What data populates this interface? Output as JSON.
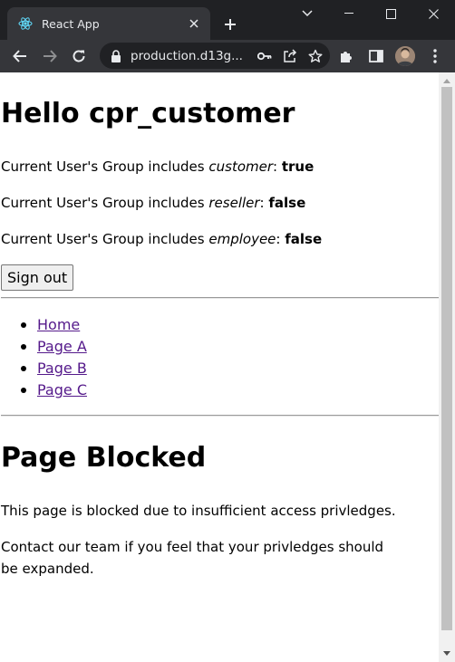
{
  "browser": {
    "tab_title": "React App",
    "url": "production.d13g..."
  },
  "page": {
    "heading": "Hello cpr_customer",
    "groups": [
      {
        "prefix": "Current User's Group includes ",
        "group": "customer",
        "sep": ": ",
        "value": "true"
      },
      {
        "prefix": "Current User's Group includes ",
        "group": "reseller",
        "sep": ": ",
        "value": "false"
      },
      {
        "prefix": "Current User's Group includes ",
        "group": "employee",
        "sep": ": ",
        "value": "false"
      }
    ],
    "sign_out_label": "Sign out",
    "nav": [
      {
        "label": "Home"
      },
      {
        "label": "Page A"
      },
      {
        "label": "Page B"
      },
      {
        "label": "Page C"
      }
    ],
    "blocked_heading": "Page Blocked",
    "blocked_text": "This page is blocked due to insufficient access privledges.",
    "contact_text": "Contact our team if you feel that your privledges should be expanded."
  },
  "colors": {
    "link": "#551a8b",
    "chrome_dark": "#202124",
    "chrome_toolbar": "#35363a"
  }
}
